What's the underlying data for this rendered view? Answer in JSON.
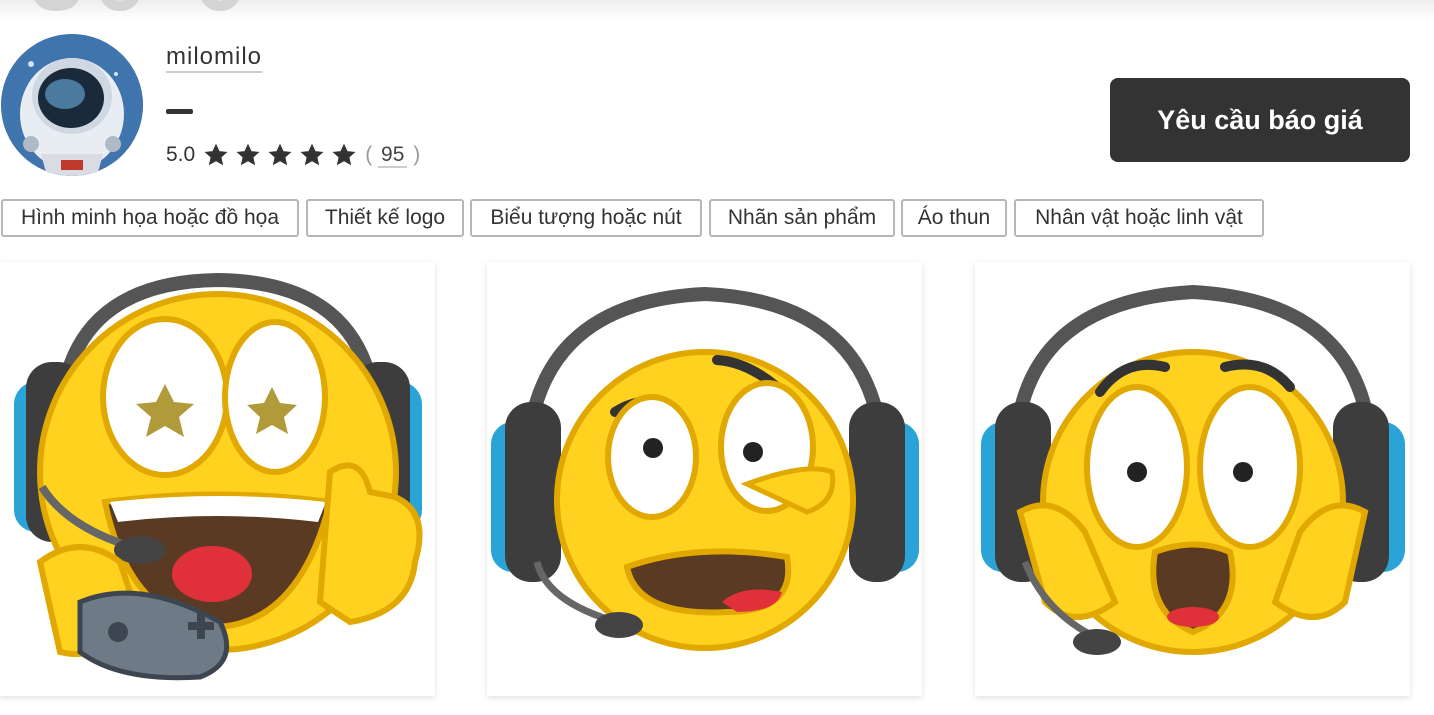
{
  "profile": {
    "background_number": "30 0",
    "username": "milomilo",
    "rating_score": "5.0",
    "rating_stars": 5,
    "review_count": "95",
    "paren_open": "(",
    "paren_close": ")"
  },
  "cta": {
    "request_quote_label": "Yêu cầu báo giá"
  },
  "tags": [
    "Hình minh họa hoặc đồ họa",
    "Thiết kế logo",
    "Biểu tượng hoặc nút",
    "Nhãn sản phẩm",
    "Áo thun",
    "Nhân vật hoặc linh vật"
  ],
  "portfolio": [
    {
      "name": "gamer emoji star eyes thumbs up"
    },
    {
      "name": "gamer emoji worried"
    },
    {
      "name": "gamer emoji shocked"
    }
  ],
  "colors": {
    "button_bg": "#333333",
    "emoji_yellow": "#ffd21f",
    "headset_gray": "#555555",
    "headset_blue": "#2aa4d6",
    "tag_border": "#b6b6b6"
  },
  "icons": [
    "avatar-astronaut",
    "star-icon",
    "headset",
    "game-controller"
  ]
}
